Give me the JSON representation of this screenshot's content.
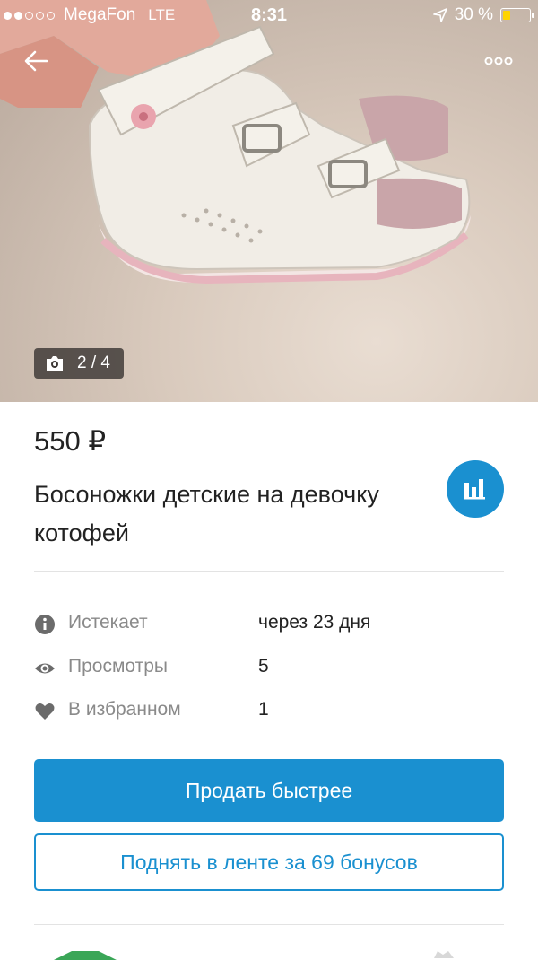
{
  "status_bar": {
    "carrier": "MegaFon",
    "network": "LTE",
    "time": "8:31",
    "battery": "30 %",
    "battery_level": 0.3,
    "signal_dots": [
      true,
      true,
      false,
      false,
      false
    ]
  },
  "gallery": {
    "counter": "2 / 4",
    "image_desc_icon": "camera-icon"
  },
  "listing": {
    "price": "550 ₽",
    "title": "Босоножки детские на девочку котофей"
  },
  "details": [
    {
      "icon": "info-icon",
      "label": "Истекает",
      "value": "через 23 дня"
    },
    {
      "icon": "eye-icon",
      "label": "Просмотры",
      "value": "5"
    },
    {
      "icon": "heart-icon",
      "label": "В избранном",
      "value": "1"
    }
  ],
  "actions": {
    "sell_faster": "Продать быстрее",
    "boost": "Поднять в ленте за 69 бонусов"
  },
  "colors": {
    "accent": "#1a90d0",
    "muted_text": "#8a8a8a",
    "battery": "#ffd400"
  }
}
